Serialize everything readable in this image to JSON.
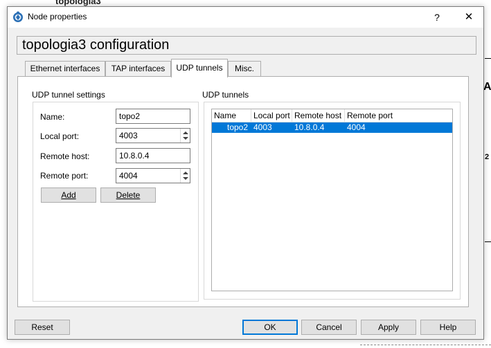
{
  "background": {
    "text_top": "topologia3",
    "text_a": "A",
    "text_2": "2"
  },
  "window": {
    "title": "Node properties",
    "help_glyph": "?",
    "close_glyph": "✕"
  },
  "header": {
    "title": "topologia3 configuration"
  },
  "tabs": [
    {
      "label": "Ethernet interfaces",
      "active": false
    },
    {
      "label": "TAP interfaces",
      "active": false
    },
    {
      "label": "UDP tunnels",
      "active": true
    },
    {
      "label": "Misc.",
      "active": false
    }
  ],
  "settings": {
    "group_title": "UDP tunnel settings",
    "name_label": "Name:",
    "name_value": "topo2",
    "local_port_label": "Local port:",
    "local_port_value": "4003",
    "remote_host_label": "Remote host:",
    "remote_host_value": "10.8.0.4",
    "remote_port_label": "Remote port:",
    "remote_port_value": "4004",
    "add_label": "Add",
    "delete_label": "Delete"
  },
  "tunnels": {
    "group_title": "UDP tunnels",
    "columns": [
      "Name",
      "Local port",
      "Remote host",
      "Remote port"
    ],
    "rows": [
      {
        "name": "topo2",
        "local_port": "4003",
        "remote_host": "10.8.0.4",
        "remote_port": "4004",
        "selected": true
      }
    ]
  },
  "footer": {
    "reset_label": "Reset",
    "ok_label": "OK",
    "cancel_label": "Cancel",
    "apply_label": "Apply",
    "help_label": "Help"
  },
  "colors": {
    "selection": "#0078d7",
    "dialog_bg": "#f0f0f0"
  }
}
